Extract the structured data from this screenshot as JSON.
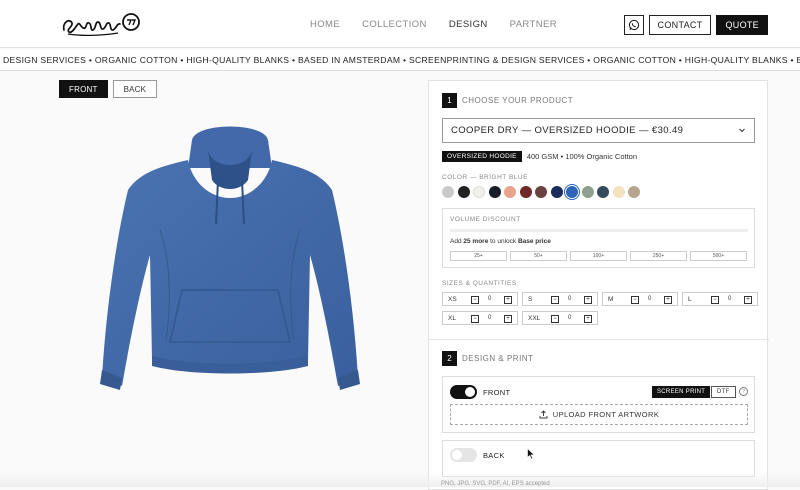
{
  "header": {
    "nav": [
      {
        "label": "HOME",
        "active": false
      },
      {
        "label": "COLLECTION",
        "active": false
      },
      {
        "label": "DESIGN",
        "active": true
      },
      {
        "label": "PARTNER",
        "active": false
      }
    ],
    "contact_label": "CONTACT",
    "quote_label": "QUOTE"
  },
  "ticker": {
    "text": "DESIGN SERVICES • ORGANIC COTTON • HIGH-QUALITY BLANKS • BASED IN AMSTERDAM • SCREENPRINTING & DESIGN SERVICES • ORGANIC COTTON • HIGH-QUALITY BLANKS • BASED IN AMSTERDAM"
  },
  "view": {
    "front_label": "FRONT",
    "back_label": "BACK"
  },
  "product": {
    "step_number": "1",
    "step_label": "CHOOSE YOUR PRODUCT",
    "selected": "COOPER DRY — OVERSIZED HOODIE — €30.49",
    "tag": "OVERSIZED HOODIE",
    "details": "400 GSM • 100% Organic Cotton",
    "color_label": "COLOR — BRIGHT BLUE",
    "colors": [
      "#c9c9c9",
      "#222222",
      "#f2f0ea",
      "#1a1c26",
      "#e8a38c",
      "#6e2a2a",
      "#6a4040",
      "#1d2a5c",
      "#2f66b3",
      "#8fa090",
      "#354a5a",
      "#f3e2bf",
      "#b5a58e"
    ],
    "selected_color_index": 8
  },
  "volume": {
    "title": "VOLUME DISCOUNT",
    "text_pre": "Add ",
    "text_bold1": "25 more",
    "text_mid": " to unlock ",
    "text_bold2": "Base price",
    "progress": 0,
    "tiers": [
      "25+",
      "50+",
      "100+",
      "250+",
      "500+"
    ]
  },
  "sizes": {
    "label": "SIZES & QUANTITIES",
    "items": [
      {
        "size": "XS",
        "qty": "0"
      },
      {
        "size": "S",
        "qty": "0"
      },
      {
        "size": "M",
        "qty": "0"
      },
      {
        "size": "L",
        "qty": "0"
      },
      {
        "size": "XL",
        "qty": "0"
      },
      {
        "size": "XXL",
        "qty": "0"
      }
    ],
    "minus": "−",
    "plus": "+"
  },
  "design": {
    "step_number": "2",
    "step_label": "DESIGN & PRINT",
    "front_label": "FRONT",
    "front_enabled": true,
    "method_screen": "SCREEN PRINT",
    "method_dtf": "DTF",
    "info_glyph": "?",
    "upload_label": "UPLOAD FRONT ARTWORK",
    "back_label": "BACK",
    "back_enabled": false,
    "formats_note": "PNG, JPG, SVG, PDF, AI, EPS accepted"
  },
  "colors": {
    "accent": "#111111",
    "product_blue": "#4169a8"
  }
}
